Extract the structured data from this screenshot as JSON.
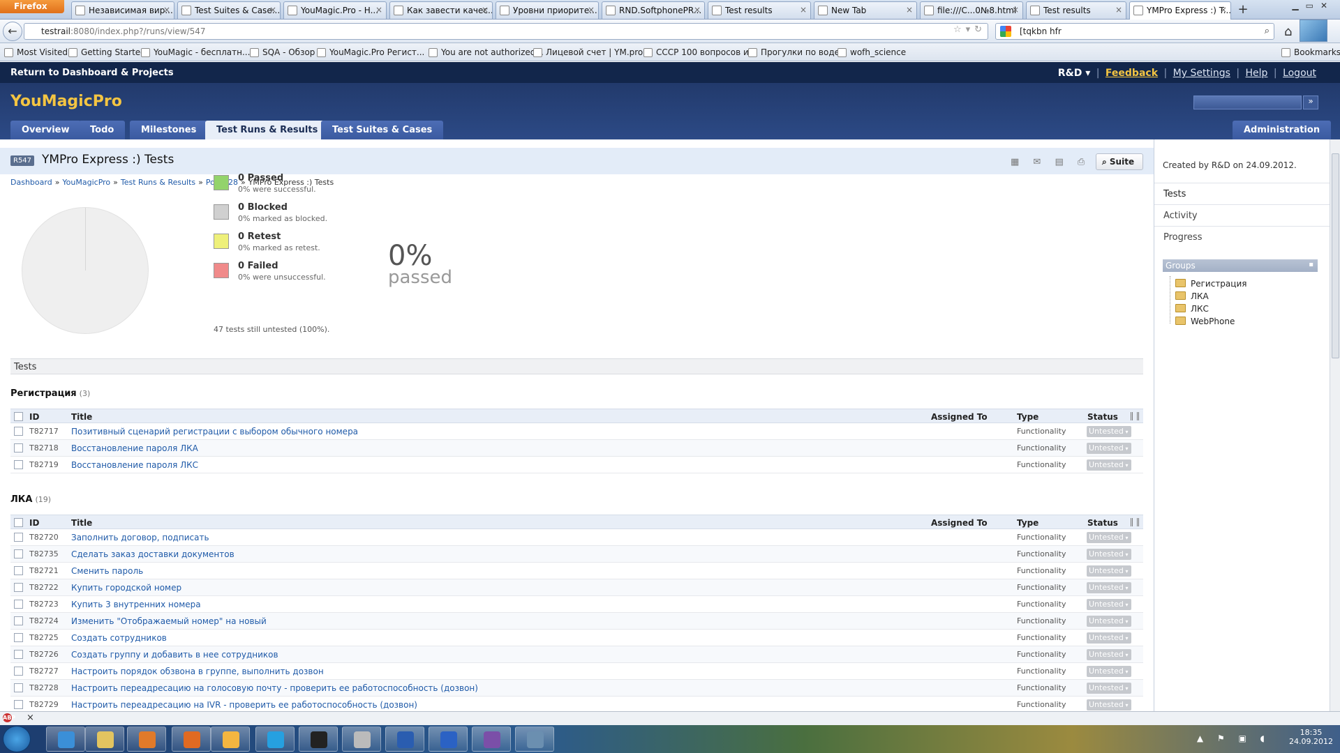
{
  "browser": {
    "menu_button": "Firefox",
    "tabs": [
      {
        "label": "Независимая вир..."
      },
      {
        "label": "Test Suites & Case..."
      },
      {
        "label": "YouMagic.Pro - H..."
      },
      {
        "label": "Как завести качес..."
      },
      {
        "label": "Уровни приорите..."
      },
      {
        "label": "RND.SoftphonePR..."
      },
      {
        "label": "Test results"
      },
      {
        "label": "New Tab"
      },
      {
        "label": "file:///C...0№8.html"
      },
      {
        "label": "Test results"
      },
      {
        "label": "YMPro Express :) T..."
      }
    ],
    "url_host": "testrail",
    "url_rest": ":8080/index.php?/runs/view/547",
    "search_value": "[tqkbn hfr",
    "bookmarks": [
      "Most Visited",
      "Getting Started",
      "YouMagic - бесплатн...",
      "SQA - Обзор",
      "YouMagic.Pro Регист...",
      "You are not authorized...",
      "Лицевой счет | YM.pro",
      "СССР 100 вопросов и...",
      "Прогулки по воде",
      "wofh_science"
    ],
    "bookmarks_menu": "Bookmarks"
  },
  "app": {
    "return_link": "Return to Dashboard & Projects",
    "project_menu": "R&D ▾",
    "links": {
      "feedback": "Feedback",
      "settings": "My Settings",
      "help": "Help",
      "logout": "Logout"
    },
    "logo": "YouMagicPro",
    "search_button": "»",
    "nav_tabs": [
      "Overview",
      "Todo",
      "Milestones",
      "Test Runs & Results",
      "Test Suites & Cases"
    ],
    "admin_tab": "Administration"
  },
  "run": {
    "badge": "R547",
    "title": "YMPro Express :) Tests",
    "suite_button": "Suite",
    "breadcrumb": [
      "Dashboard",
      "YouMagicPro",
      "Test Runs & Results",
      "Porta 28",
      "YMPro Express :) Tests"
    ],
    "breadcrumb_sep": "»"
  },
  "stats": {
    "passed": {
      "title": "0 Passed",
      "sub": "0% were successful.",
      "color": "#93d36b"
    },
    "blocked": {
      "title": "0 Blocked",
      "sub": "0% marked as blocked.",
      "color": "#d0d0d0"
    },
    "retest": {
      "title": "0 Retest",
      "sub": "0% marked as retest.",
      "color": "#eef07a"
    },
    "failed": {
      "title": "0 Failed",
      "sub": "0% were unsuccessful.",
      "color": "#f08a8a"
    },
    "untested": "47 tests still untested (100%).",
    "percent": "0%",
    "percent_label": "passed",
    "passed_fraction": 0
  },
  "tests_header": "Tests",
  "columns": {
    "id": "ID",
    "title": "Title",
    "assigned": "Assigned To",
    "type": "Type",
    "status": "Status"
  },
  "groups": [
    {
      "name": "Регистрация",
      "count": "(3)",
      "rows": [
        {
          "id": "T82717",
          "title": "Позитивный сценарий регистрации с выбором обычного номера",
          "type": "Functionality",
          "status": "Untested"
        },
        {
          "id": "T82718",
          "title": "Восстановление пароля ЛКА",
          "type": "Functionality",
          "status": "Untested"
        },
        {
          "id": "T82719",
          "title": "Восстановление пароля ЛКС",
          "type": "Functionality",
          "status": "Untested"
        }
      ]
    },
    {
      "name": "ЛКА",
      "count": "(19)",
      "rows": [
        {
          "id": "T82720",
          "title": "Заполнить договор, подписать",
          "type": "Functionality",
          "status": "Untested"
        },
        {
          "id": "T82735",
          "title": "Сделать заказ доставки документов",
          "type": "Functionality",
          "status": "Untested"
        },
        {
          "id": "T82721",
          "title": "Сменить пароль",
          "type": "Functionality",
          "status": "Untested"
        },
        {
          "id": "T82722",
          "title": "Купить городской номер",
          "type": "Functionality",
          "status": "Untested"
        },
        {
          "id": "T82723",
          "title": "Купить 3 внутренних номера",
          "type": "Functionality",
          "status": "Untested"
        },
        {
          "id": "T82724",
          "title": "Изменить \"Отображаемый номер\" на новый",
          "type": "Functionality",
          "status": "Untested"
        },
        {
          "id": "T82725",
          "title": "Создать сотрудников",
          "type": "Functionality",
          "status": "Untested"
        },
        {
          "id": "T82726",
          "title": "Создать группу и добавить в нее сотрудников",
          "type": "Functionality",
          "status": "Untested"
        },
        {
          "id": "T82727",
          "title": "Настроить порядок обзвона в группе, выполнить дозвон",
          "type": "Functionality",
          "status": "Untested"
        },
        {
          "id": "T82728",
          "title": "Настроить переадресацию на голосовую почту - проверить ее работоспособность (дозвон)",
          "type": "Functionality",
          "status": "Untested"
        },
        {
          "id": "T82729",
          "title": "Настроить переадресацию на IVR - проверить ее работоспособность (дозвон)",
          "type": "Functionality",
          "status": "Untested"
        }
      ]
    }
  ],
  "sidebar": {
    "created": "Created by R&D on 24.09.2012.",
    "items": [
      "Tests",
      "Activity",
      "Progress"
    ],
    "groups_title": "Groups",
    "groups": [
      "Регистрация",
      "ЛКА",
      "ЛКС",
      "WebPhone"
    ]
  },
  "taskbar": {
    "time": "18:35",
    "date": "24.09.2012"
  }
}
